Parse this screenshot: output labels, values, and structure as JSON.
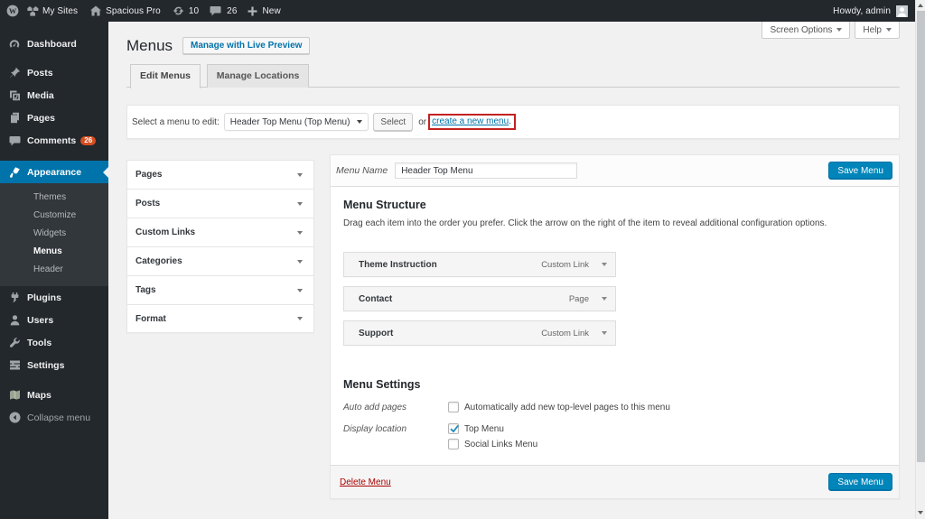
{
  "admin_bar": {
    "wp_logo_icon": "wordpress-logo-icon",
    "my_sites": {
      "label": "My Sites",
      "icon": "network-icon"
    },
    "site": {
      "label": "Spacious Pro",
      "icon": "home-icon"
    },
    "updates": {
      "count": "10",
      "icon": "updates-icon"
    },
    "comments": {
      "count": "26",
      "icon": "comment-icon"
    },
    "new_item": {
      "label": "New",
      "icon": "plus-icon"
    },
    "howdy": "Howdy, admin"
  },
  "sidebar": {
    "items": [
      {
        "label": "Dashboard",
        "icon": "dashboard-icon"
      },
      {
        "label": "Posts",
        "icon": "pin-icon"
      },
      {
        "label": "Media",
        "icon": "media-icon"
      },
      {
        "label": "Pages",
        "icon": "pages-icon"
      },
      {
        "label": "Comments",
        "icon": "comment-icon",
        "badge": "26"
      },
      {
        "label": "Appearance",
        "icon": "brush-icon",
        "active": true
      },
      {
        "label": "Plugins",
        "icon": "plugin-icon"
      },
      {
        "label": "Users",
        "icon": "user-icon"
      },
      {
        "label": "Tools",
        "icon": "tools-icon"
      },
      {
        "label": "Settings",
        "icon": "settings-icon"
      },
      {
        "label": "Maps",
        "icon": "map-icon"
      }
    ],
    "appearance_submenu": [
      {
        "label": "Themes"
      },
      {
        "label": "Customize"
      },
      {
        "label": "Widgets"
      },
      {
        "label": "Menus",
        "current": true
      },
      {
        "label": "Header"
      }
    ],
    "collapse": {
      "label": "Collapse menu",
      "icon": "collapse-arrow-icon"
    }
  },
  "screen_meta": {
    "screen_options": "Screen Options",
    "help": "Help"
  },
  "page": {
    "title": "Menus",
    "live_preview_button": "Manage with Live Preview",
    "tabs": [
      {
        "label": "Edit Menus",
        "active": true
      },
      {
        "label": "Manage Locations",
        "active": false
      }
    ]
  },
  "manage_menus": {
    "label": "Select a menu to edit:",
    "select_value": "Header Top Menu (Top Menu)",
    "select_button": "Select",
    "or_text": "or",
    "create_link": "create a new menu",
    "after_link": ".",
    "annotation_color": "#c32121"
  },
  "accordion": {
    "sections": [
      {
        "label": "Pages"
      },
      {
        "label": "Posts"
      },
      {
        "label": "Custom Links"
      },
      {
        "label": "Categories"
      },
      {
        "label": "Tags"
      },
      {
        "label": "Format"
      }
    ]
  },
  "editor": {
    "menu_name_label": "Menu Name",
    "menu_name_value": "Header Top Menu",
    "save_button": "Save Menu",
    "structure": {
      "heading": "Menu Structure",
      "description": "Drag each item into the order you prefer. Click the arrow on the right of the item to reveal additional configuration options.",
      "items": [
        {
          "label": "Theme Instruction",
          "type": "Custom Link"
        },
        {
          "label": "Contact",
          "type": "Page"
        },
        {
          "label": "Support",
          "type": "Custom Link"
        }
      ]
    },
    "settings": {
      "heading": "Menu Settings",
      "auto_add": {
        "label": "Auto add pages",
        "option": "Automatically add new top-level pages to this menu",
        "checked": false
      },
      "display_location": {
        "label": "Display location",
        "options": [
          {
            "label": "Top Menu",
            "checked": true
          },
          {
            "label": "Social Links Menu",
            "checked": false
          }
        ]
      }
    },
    "delete_link": "Delete Menu",
    "footer_save_button": "Save Menu"
  },
  "colors": {
    "admin_dark": "#23282d",
    "submenu_dark": "#32373c",
    "highlight_blue": "#0073aa",
    "button_primary": "#0085ba",
    "link_blue": "#0073aa",
    "badge_orange": "#d54e21",
    "annotation_red": "#c32121",
    "page_background": "#f1f1f1"
  }
}
